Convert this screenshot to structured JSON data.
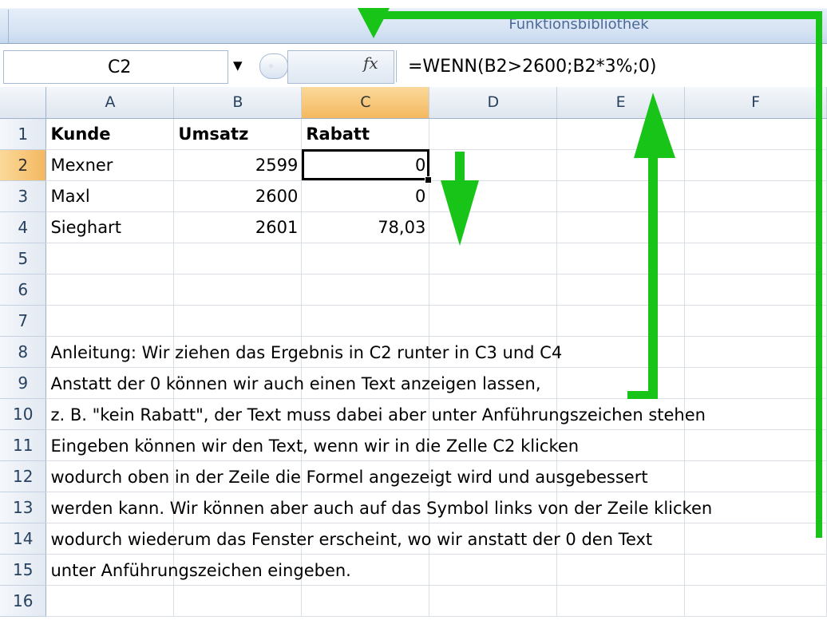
{
  "ribbon": {
    "group_label": "Funktionsbibliothek"
  },
  "formula_bar": {
    "name_box": "C2",
    "fx_label": "fx",
    "formula": "=WENN(B2>2600;B2*3%;0)"
  },
  "columns": [
    "A",
    "B",
    "C",
    "D",
    "E",
    "F"
  ],
  "rows": [
    "1",
    "2",
    "3",
    "4",
    "5",
    "6",
    "7",
    "8",
    "9",
    "10",
    "11",
    "12",
    "13",
    "14",
    "15",
    "16"
  ],
  "cells": {
    "A1": "Kunde",
    "B1": "Umsatz",
    "C1": "Rabatt",
    "A2": "Mexner",
    "B2": "2599",
    "C2": "0",
    "A3": "Maxl",
    "B3": "2600",
    "C3": "0",
    "A4": "Sieghart",
    "B4": "2601",
    "C4": "78,03"
  },
  "notes": [
    "Anleitung: Wir ziehen das Ergebnis in C2 runter in C3 und C4",
    "Anstatt der 0 können wir auch einen Text anzeigen lassen,",
    "z. B. \"kein Rabatt\", der Text muss dabei aber unter Anführungszeichen stehen",
    "Eingeben können wir den Text, wenn wir in die Zelle C2 klicken",
    "wodurch oben in der Zeile die Formel angezeigt wird und ausgebessert",
    "werden kann. Wir können aber auch auf das Symbol links von der Zeile klicken",
    "wodurch wiederum das Fenster erscheint, wo wir anstatt der 0 den Text",
    "unter Anführungszeichen eingeben."
  ],
  "colors": {
    "annotation": "#19c419",
    "selected_header": "#f4b860",
    "header": "#dfe6ef"
  }
}
